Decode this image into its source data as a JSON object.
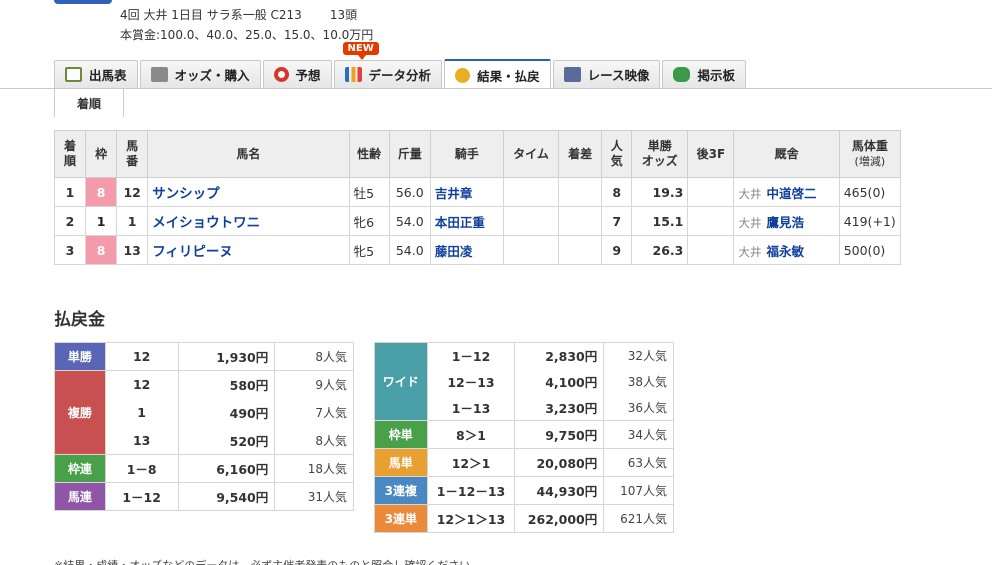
{
  "race": {
    "line1": "4回 大井 1日目 サラ系一般 C213",
    "count": "13頭",
    "prize": "本賞金:100.0、40.0、25.0、15.0、10.0万円"
  },
  "tabs": [
    {
      "label": "出馬表",
      "icon": "table-icon",
      "color": "#6c8a3a"
    },
    {
      "label": "オッズ・購入",
      "icon": "odds-icon",
      "color": "#7a7a7a"
    },
    {
      "label": "予想",
      "icon": "target-icon",
      "color": "#d8352a"
    },
    {
      "label": "データ分析",
      "icon": "bar-chart-icon",
      "color": "#f0a020",
      "badge": "NEW"
    },
    {
      "label": "結果・払戻",
      "icon": "coins-icon",
      "color": "#e0a020",
      "active": true
    },
    {
      "label": "レース映像",
      "icon": "video-icon",
      "color": "#5a6a9a"
    },
    {
      "label": "掲示板",
      "icon": "chat-icon",
      "color": "#3a9a4a"
    }
  ],
  "subtab": "着順",
  "results": {
    "headers": {
      "rank": [
        "着",
        "順"
      ],
      "frame": "枠",
      "num": [
        "馬",
        "番"
      ],
      "horse": "馬名",
      "sexage": "性齢",
      "weight": "斤量",
      "jockey": "騎手",
      "time": "タイム",
      "margin": "着差",
      "pop": [
        "人",
        "気"
      ],
      "odds": [
        "単勝",
        "オッズ"
      ],
      "last3f": "後3F",
      "trainer": "厩舎",
      "bodyweight": [
        "馬体重",
        "(増減)"
      ]
    },
    "rows": [
      {
        "rank": "1",
        "frame": "8",
        "num": "12",
        "horse": "サンシップ",
        "sexage": "牡5",
        "weight": "56.0",
        "jockey": "吉井章",
        "time": "",
        "margin": "",
        "pop": "8",
        "odds": "19.3",
        "last3f": "",
        "trainer_loc": "大井",
        "trainer": "中道啓二",
        "bodyweight": "465(0)"
      },
      {
        "rank": "2",
        "frame": "1",
        "num": "1",
        "horse": "メイショウトワニ",
        "sexage": "牝6",
        "weight": "54.0",
        "jockey": "本田正重",
        "time": "",
        "margin": "",
        "pop": "7",
        "odds": "15.1",
        "last3f": "",
        "trainer_loc": "大井",
        "trainer": "鷹見浩",
        "bodyweight": "419(+1)"
      },
      {
        "rank": "3",
        "frame": "8",
        "num": "13",
        "horse": "フィリピーヌ",
        "sexage": "牝5",
        "weight": "54.0",
        "jockey": "藤田凌",
        "time": "",
        "margin": "",
        "pop": "9",
        "odds": "26.3",
        "last3f": "",
        "trainer_loc": "大井",
        "trainer": "福永敏",
        "bodyweight": "500(0)"
      }
    ]
  },
  "payout": {
    "title": "払戻金",
    "left": {
      "tansho": {
        "label": "単勝",
        "combo": "12",
        "amount": "1,930円",
        "pop": "8人気"
      },
      "fukusho": {
        "label": "複勝",
        "rows": [
          {
            "combo": "12",
            "amount": "580円",
            "pop": "9人気"
          },
          {
            "combo": "1",
            "amount": "490円",
            "pop": "7人気"
          },
          {
            "combo": "13",
            "amount": "520円",
            "pop": "8人気"
          }
        ]
      },
      "wakuren": {
        "label": "枠連",
        "combo": "1－8",
        "amount": "6,160円",
        "pop": "18人気"
      },
      "umaren": {
        "label": "馬連",
        "combo": "1－12",
        "amount": "9,540円",
        "pop": "31人気"
      }
    },
    "right": {
      "wide": {
        "label": "ワイド",
        "rows": [
          {
            "combo": "1－12",
            "amount": "2,830円",
            "pop": "32人気"
          },
          {
            "combo": "12－13",
            "amount": "4,100円",
            "pop": "38人気"
          },
          {
            "combo": "1－13",
            "amount": "3,230円",
            "pop": "36人気"
          }
        ]
      },
      "wakutan": {
        "label": "枠単",
        "combo": "8＞1",
        "amount": "9,750円",
        "pop": "34人気"
      },
      "umatan": {
        "label": "馬単",
        "combo": "12＞1",
        "amount": "20,080円",
        "pop": "63人気"
      },
      "sanrenpuku": {
        "label": "3連複",
        "combo": "1－12－13",
        "amount": "44,930円",
        "pop": "107人気"
      },
      "sanrentan": {
        "label": "3連単",
        "combo": "12＞1＞13",
        "amount": "262,000円",
        "pop": "621人気"
      }
    }
  },
  "note": "※結果・成績・オッズなどのデータは、必ず主催者発表のものと照合し確認ください。"
}
